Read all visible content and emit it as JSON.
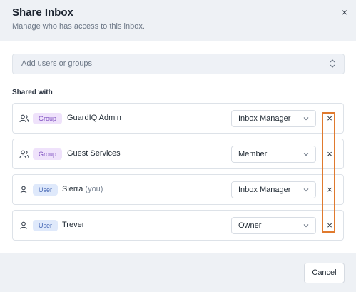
{
  "header": {
    "title": "Share Inbox",
    "subtitle": "Manage who has access to this inbox.",
    "close_label": "×"
  },
  "add_field": {
    "placeholder": "Add users or groups",
    "icon": "updown-chevron-icon"
  },
  "section_label": "Shared with",
  "rows": [
    {
      "kind_icon": "users-icon",
      "badge": "Group",
      "name": "GuardIQ Admin",
      "you": "",
      "role": "Inbox Manager",
      "remove": "×"
    },
    {
      "kind_icon": "users-icon",
      "badge": "Group",
      "name": "Guest Services",
      "you": "",
      "role": "Member",
      "remove": "×"
    },
    {
      "kind_icon": "user-icon",
      "badge": "User",
      "name": "Sierra",
      "you": "(you)",
      "role": "Inbox Manager",
      "remove": "×"
    },
    {
      "kind_icon": "user-icon",
      "badge": "User",
      "name": "Trever",
      "you": "",
      "role": "Owner",
      "remove": "×"
    }
  ],
  "footer": {
    "cancel_label": "Cancel"
  },
  "colors": {
    "group_badge_bg": "#efe2fb",
    "group_badge_text": "#7c4dbf",
    "user_badge_bg": "#dfe9fb",
    "user_badge_text": "#4768b5",
    "highlight": "#e07a2e"
  }
}
